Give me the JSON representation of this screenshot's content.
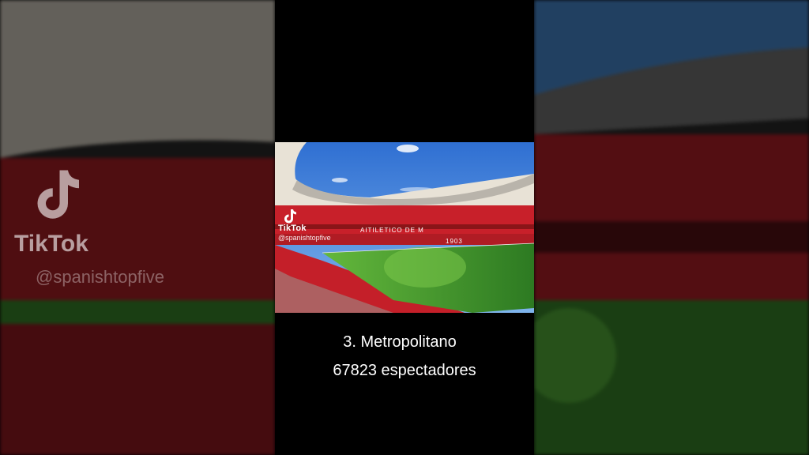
{
  "watermark": {
    "brand": "TikTok",
    "username": "@spanishtopfive",
    "icon": "tiktok-logo-icon"
  },
  "caption": {
    "title": "3. Metropolitano",
    "subtitle": "67823 espectadores"
  },
  "stadium_banner": {
    "text": "AITILETICO DE M",
    "year": "1903"
  },
  "colors": {
    "sky": "#4a8fd8",
    "seats": "#c8202a",
    "pitch": "#3f9a2e",
    "roof": "#e8e2d6"
  }
}
